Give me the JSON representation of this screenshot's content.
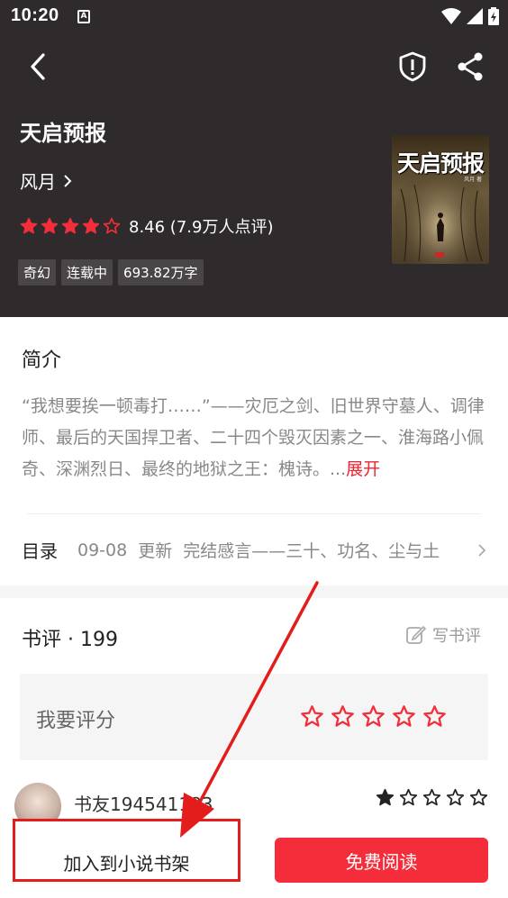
{
  "status_bar": {
    "time": "10:20",
    "notif_badge": "A"
  },
  "book": {
    "title": "天启预报",
    "author": "风月",
    "rating": 8.46,
    "rating_text": "8.46 (7.9万人点评)",
    "stars_filled": 4,
    "stars_total": 5,
    "tags": [
      "奇幻",
      "连载中",
      "693.82万字"
    ],
    "cover_title": "天启预报",
    "cover_author": "风月 著"
  },
  "intro": {
    "heading": "简介",
    "text": "“我想要挨一顿毒打……”——灾厄之剑、旧世界守墓人、调律师、最后的天国捍卫者、二十四个毁灭因素之一、淮海路小佩奇、深渊烈日、最终的地狱之王：槐诗。...",
    "more_label": "展开"
  },
  "toc": {
    "label": "目录",
    "date": "09-08",
    "update_label": "更新",
    "latest_chapter": "完结感言——三十、功名、尘与土"
  },
  "reviews": {
    "heading": "书评 · 199",
    "write_label": "写书评",
    "rate_prompt": "我要评分",
    "first_review": {
      "user": "书友194541183",
      "stars_filled": 1
    }
  },
  "bottom": {
    "add_shelf_label": "加入到小说书架",
    "read_label": "免费阅读"
  },
  "colors": {
    "header_bg": "#2f2b2c",
    "accent_red": "#f52d3b",
    "annotation_red": "#e31c1c"
  }
}
